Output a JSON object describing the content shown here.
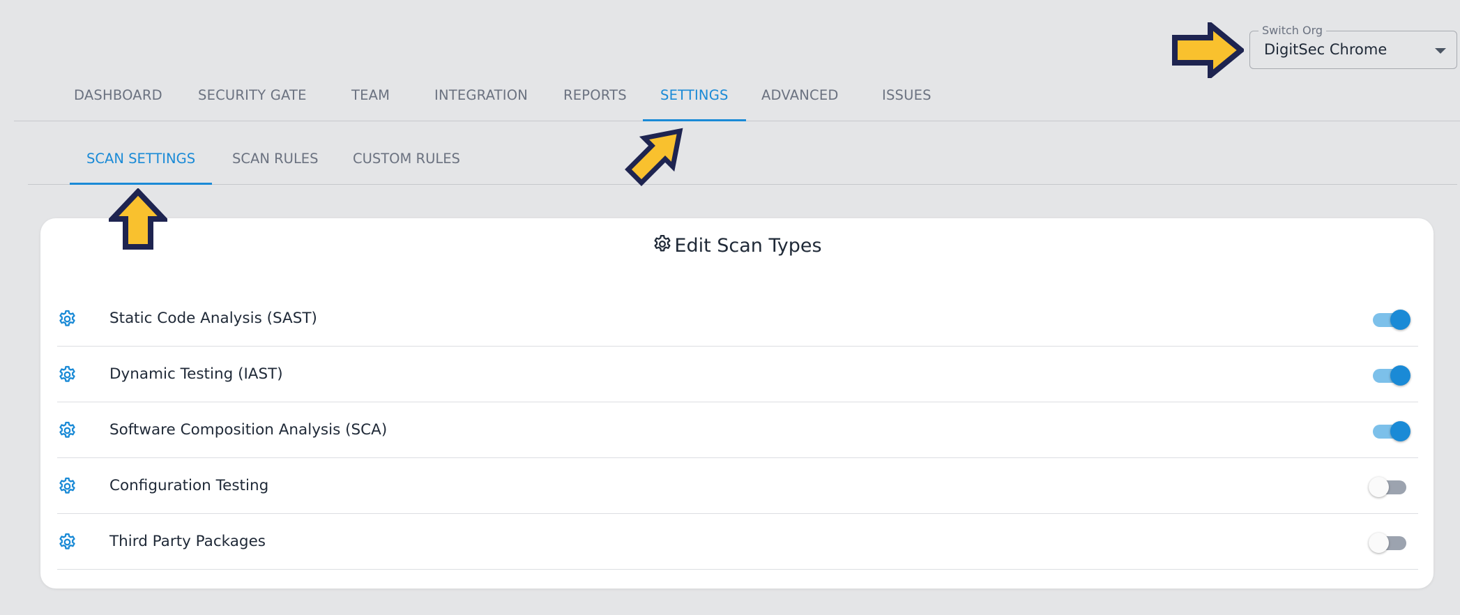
{
  "org_switcher": {
    "label": "Switch Org",
    "value": "DigitSec Chrome"
  },
  "main_nav": {
    "tabs": [
      {
        "label": "DASHBOARD",
        "active": false
      },
      {
        "label": "SECURITY GATE",
        "active": false
      },
      {
        "label": "TEAM",
        "active": false
      },
      {
        "label": "INTEGRATION",
        "active": false
      },
      {
        "label": "REPORTS",
        "active": false
      },
      {
        "label": "SETTINGS",
        "active": true
      },
      {
        "label": "ADVANCED",
        "active": false
      },
      {
        "label": "ISSUES",
        "active": false
      }
    ]
  },
  "sub_nav": {
    "tabs": [
      {
        "label": "SCAN SETTINGS",
        "active": true
      },
      {
        "label": "SCAN RULES",
        "active": false
      },
      {
        "label": "CUSTOM RULES",
        "active": false
      }
    ]
  },
  "card": {
    "title": "Edit Scan Types",
    "title_icon": "gear-icon",
    "rows": [
      {
        "label": "Static Code Analysis (SAST)",
        "icon": "gear-icon",
        "enabled": true
      },
      {
        "label": "Dynamic Testing (IAST)",
        "icon": "gear-icon",
        "enabled": true
      },
      {
        "label": "Software Composition Analysis (SCA)",
        "icon": "gear-icon",
        "enabled": true
      },
      {
        "label": "Configuration Testing",
        "icon": "gear-icon",
        "enabled": false
      },
      {
        "label": "Third Party Packages",
        "icon": "gear-icon",
        "enabled": false
      }
    ]
  },
  "colors": {
    "accent": "#1a8ad6",
    "toggle_on_track": "#7cc0ea",
    "toggle_off_track": "#9ca3af",
    "annotation_arrow_fill": "#f9c12e",
    "annotation_arrow_border": "#1e2450",
    "page_background": "#e4e5e7"
  }
}
